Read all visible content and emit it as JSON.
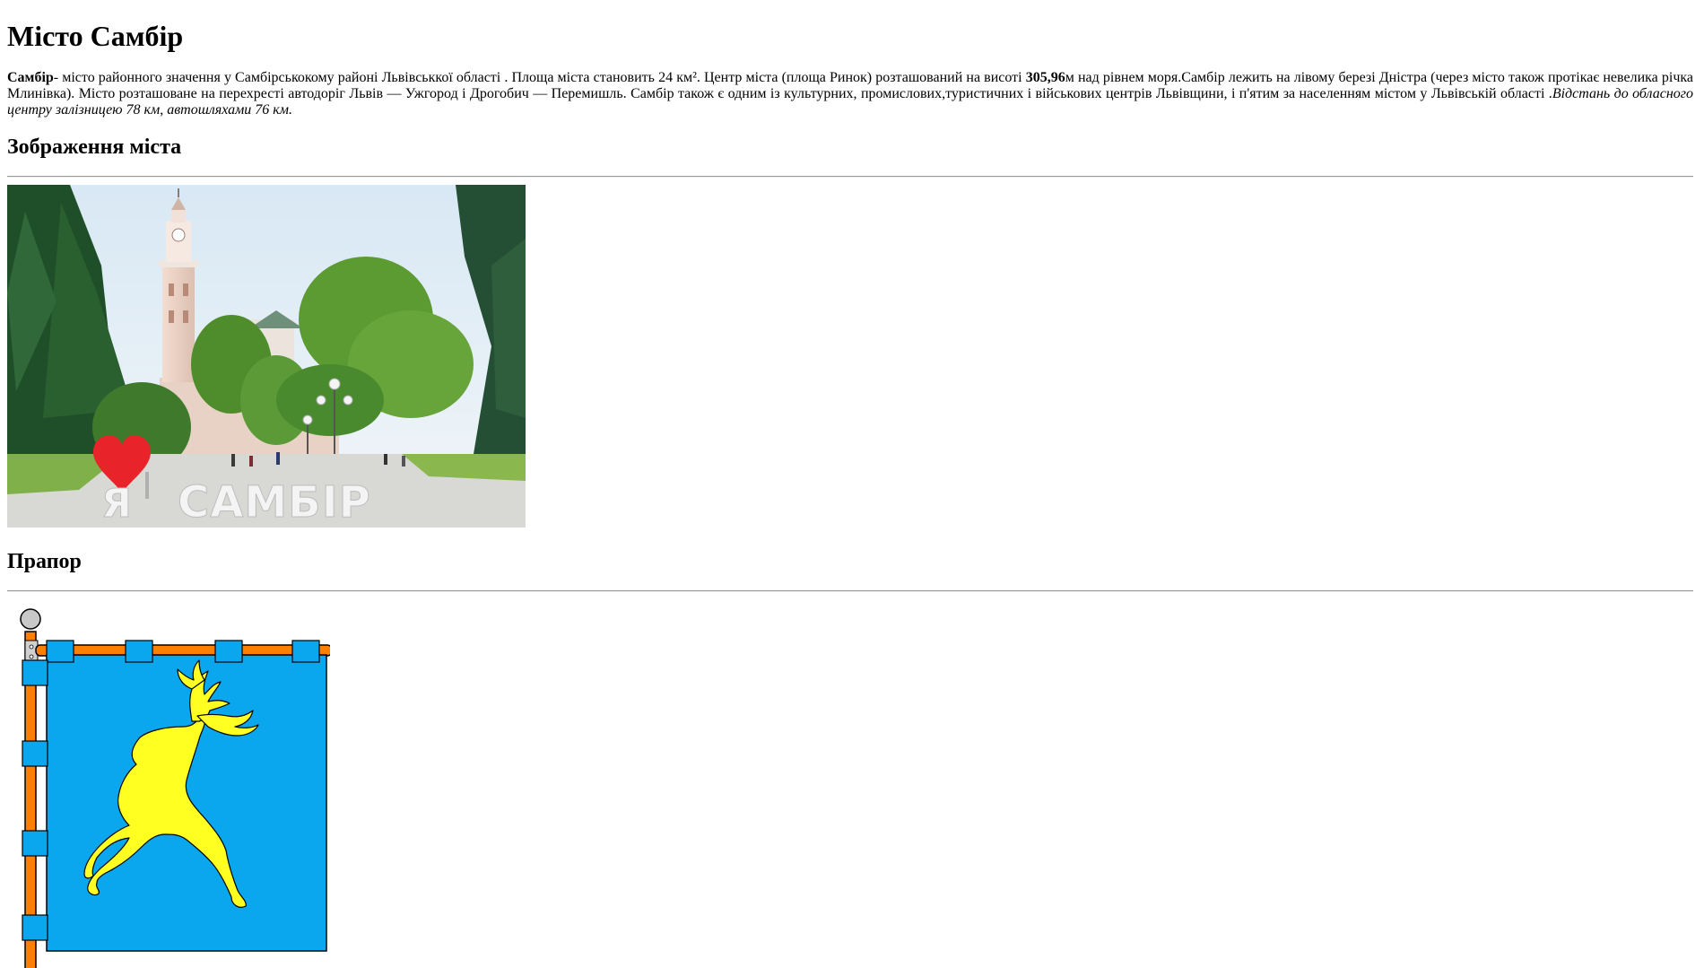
{
  "page": {
    "title": "Місто Самбір"
  },
  "intro": {
    "city_name": "Самбір",
    "text_part1": "- місто районного значення у Самбірськокому районі Львівськкої області . Площа міста становить 24 км². Центр міста (площа Ринок) розташований на висоті ",
    "height_value": "305,96",
    "text_part2": "м над рівнем моря.Самбір лежить на лівому березі Дністра (через місто також протікає невелика річка Млинівка). Місто розташоване на перехресті автодоріг Львів — Ужгород і Дрогобич — Перемишль. Самбір також є одним із культурних, промислових,туристичних і військових центрів Львівщини, і п'ятим за населенням містом у Львівській області .",
    "distance_note": "Відстань до обласного центру залізницею 78 км, автошляхами 76 км."
  },
  "gallery": {
    "heading": "Зображення міста",
    "photo_sign_text": "САМБІР",
    "photo_sign_letter": "Я"
  },
  "flag": {
    "heading": "Прапор"
  },
  "colors": {
    "flag_blue": "#0aa6ee",
    "flag_yellow": "#ffff22",
    "pole_orange": "#ff7f00",
    "sign_red": "#e8242a"
  }
}
